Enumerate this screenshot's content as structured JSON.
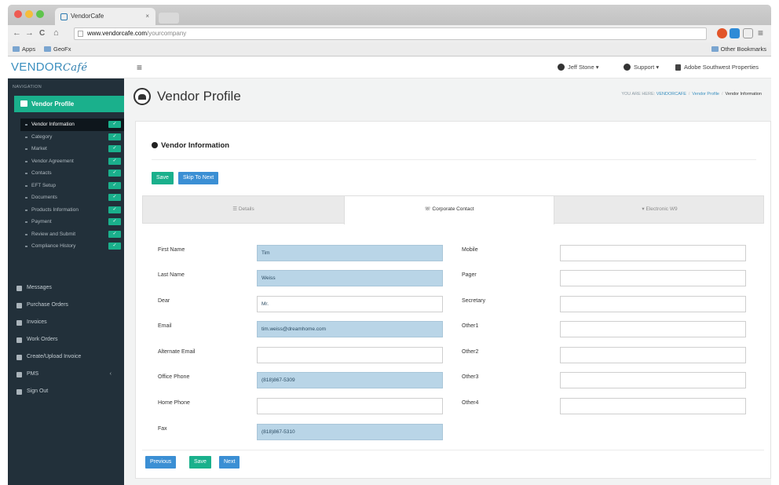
{
  "browser": {
    "tab_title": "VendorCafe",
    "tab_close": "×",
    "nav_back": "←",
    "nav_forward": "→",
    "nav_reload": "C",
    "nav_home": "⌂",
    "url_host": "www.vendorcafe.com",
    "url_path": "/yourcompany",
    "menu_icon": "≡",
    "bookmarks": {
      "apps": "Apps",
      "ceo": "GeoFx",
      "other": "Other Bookmarks"
    }
  },
  "header": {
    "logo_text": "VENDOR",
    "logo_script": "Café",
    "hamburger": "≡",
    "user": "Jeff Stone ▾",
    "support": "Support ▾",
    "property": "Adobe Southwest Properties"
  },
  "sidebar": {
    "caption": "NAVIGATION",
    "active": "Vendor Profile",
    "sub_items": [
      {
        "label": "Vendor Information",
        "check": "✓"
      },
      {
        "label": "Category",
        "check": "✓"
      },
      {
        "label": "Market",
        "check": "✓"
      },
      {
        "label": "Vendor Agreement",
        "check": "✓"
      },
      {
        "label": "Contacts",
        "check": "✓"
      },
      {
        "label": "EFT Setup",
        "check": "✓"
      },
      {
        "label": "Documents",
        "check": "✓"
      },
      {
        "label": "Products Information",
        "check": "✓"
      },
      {
        "label": "Payment",
        "check": "✓"
      },
      {
        "label": "Review and Submit",
        "check": "✓"
      },
      {
        "label": "Compliance History",
        "check": "✓"
      }
    ],
    "main_items": [
      {
        "label": "Messages"
      },
      {
        "label": "Purchase Orders"
      },
      {
        "label": "Invoices"
      },
      {
        "label": "Work Orders"
      },
      {
        "label": "Create/Upload Invoice"
      },
      {
        "label": "PMS",
        "caret": "‹"
      },
      {
        "label": "Sign Out"
      }
    ]
  },
  "page": {
    "title": "Vendor Profile",
    "breadcrumb": {
      "prefix": "YOU ARE HERE:",
      "root": "VENDORCAFE",
      "parent": "Vendor Profile",
      "current": "Vendor Information"
    }
  },
  "card": {
    "section_title": "Vendor Information",
    "save_label": "Save",
    "skip_label": "Skip To Next",
    "tabs": [
      {
        "label": "☰ Details"
      },
      {
        "label": "☏ Corporate Contact"
      },
      {
        "label": "▾ Electronic W9"
      }
    ],
    "left_fields": [
      {
        "label": "First Name",
        "value": "Tim",
        "filled": true
      },
      {
        "label": "Last Name",
        "value": "Weiss",
        "filled": true
      },
      {
        "label": "Dear",
        "value": "Mr.",
        "filled": false
      },
      {
        "label": "Email",
        "value": "tim.weiss@dreamhome.com",
        "filled": true
      },
      {
        "label": "Alternate Email",
        "value": "",
        "filled": false
      },
      {
        "label": "Office Phone",
        "value": "(818)867-5309",
        "filled": true
      },
      {
        "label": "Home Phone",
        "value": "",
        "filled": false
      },
      {
        "label": "Fax",
        "value": "(818)867-5310",
        "filled": true
      }
    ],
    "right_fields": [
      {
        "label": "Mobile",
        "value": ""
      },
      {
        "label": "Pager",
        "value": ""
      },
      {
        "label": "Secretary",
        "value": ""
      },
      {
        "label": "Other1",
        "value": ""
      },
      {
        "label": "Other2",
        "value": ""
      },
      {
        "label": "Other3",
        "value": ""
      },
      {
        "label": "Other4",
        "value": ""
      }
    ],
    "previous_label": "Previous",
    "save_bottom_label": "Save",
    "next_label": "Next"
  }
}
